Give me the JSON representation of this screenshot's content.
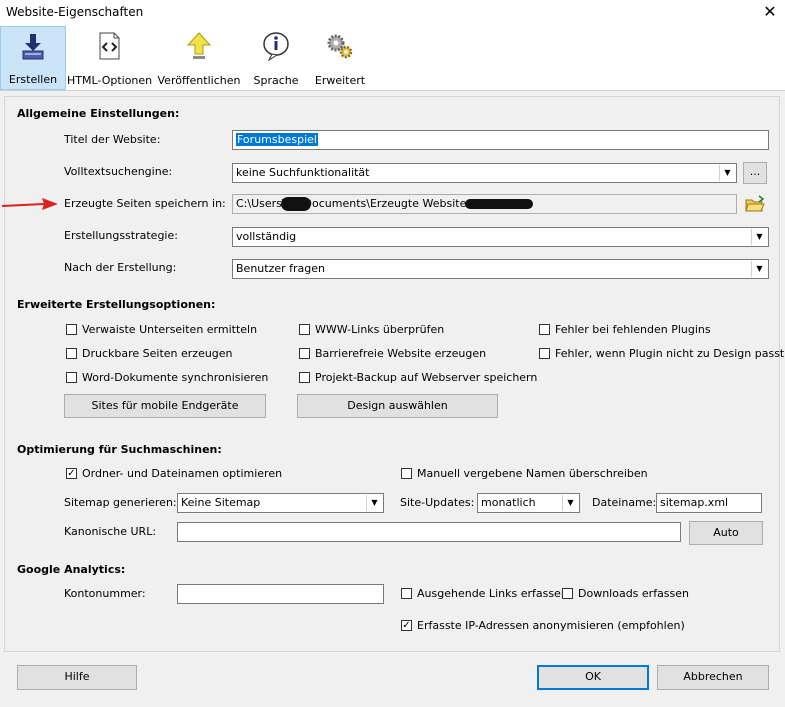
{
  "window": {
    "title": "Website-Eigenschaften"
  },
  "toolbar": {
    "items": [
      {
        "label": "Erstellen",
        "icon": "download-icon"
      },
      {
        "label": "HTML-Optionen",
        "icon": "code-icon"
      },
      {
        "label": "Veröffentlichen",
        "icon": "upload-arrow-icon"
      },
      {
        "label": "Sprache",
        "icon": "info-speech-icon"
      },
      {
        "label": "Erweitert",
        "icon": "gears-icon"
      }
    ]
  },
  "general": {
    "heading": "Allgemeine Einstellungen:",
    "site_title_label": "Titel der Website:",
    "site_title_value": "Forumsbespiel",
    "search_label": "Volltextsuchengine:",
    "search_value": "keine Suchfunktionalität",
    "more_label": "...",
    "path_label": "Erzeugte Seiten speichern in:",
    "path_value": "C:\\Users\\m     \\Documents\\Erzeugte Websites\\",
    "strategy_label": "Erstellungsstrategie:",
    "strategy_value": "vollständig",
    "after_label": "Nach der Erstellung:",
    "after_value": "Benutzer fragen"
  },
  "advanced": {
    "heading": "Erweiterte Erstellungsoptionen:",
    "checkboxes": [
      {
        "label": "Verwaiste Unterseiten ermitteln",
        "checked": false
      },
      {
        "label": "Druckbare Seiten erzeugen",
        "checked": false
      },
      {
        "label": "Word-Dokumente synchronisieren",
        "checked": false
      },
      {
        "label": "WWW-Links überprüfen",
        "checked": false
      },
      {
        "label": "Barrierefreie Website erzeugen",
        "checked": false
      },
      {
        "label": "Projekt-Backup auf Webserver speichern",
        "checked": false
      },
      {
        "label": "Fehler bei fehlenden Plugins",
        "checked": false
      },
      {
        "label": "Fehler, wenn Plugin nicht zu Design passt",
        "checked": false
      }
    ],
    "mobile_button": "Sites für mobile Endgeräte",
    "design_button": "Design auswählen"
  },
  "seo": {
    "heading": "Optimierung für Suchmaschinen:",
    "optimize_label": "Ordner- und Dateinamen optimieren",
    "optimize_checked": true,
    "override_label": "Manuell vergebene Namen überschreiben",
    "override_checked": false,
    "sitemap_label": "Sitemap generieren:",
    "sitemap_value": "Keine Sitemap",
    "updates_label": "Site-Updates:",
    "updates_value": "monatlich",
    "filename_label": "Dateiname:",
    "filename_value": "sitemap.xml",
    "canonical_label": "Kanonische URL:",
    "canonical_value": "",
    "auto_button": "Auto"
  },
  "analytics": {
    "heading": "Google Analytics:",
    "account_label": "Kontonummer:",
    "account_value": "",
    "outgoing_label": "Ausgehende Links erfassen",
    "outgoing_checked": false,
    "downloads_label": "Downloads erfassen",
    "downloads_checked": false,
    "anonymize_label": "Erfasste IP-Adressen anonymisieren (empfohlen)",
    "anonymize_checked": true
  },
  "footer": {
    "help": "Hilfe",
    "ok": "OK",
    "cancel": "Abbrechen"
  },
  "colors": {
    "accent": "#0078d7",
    "arrow": "#e02020"
  }
}
